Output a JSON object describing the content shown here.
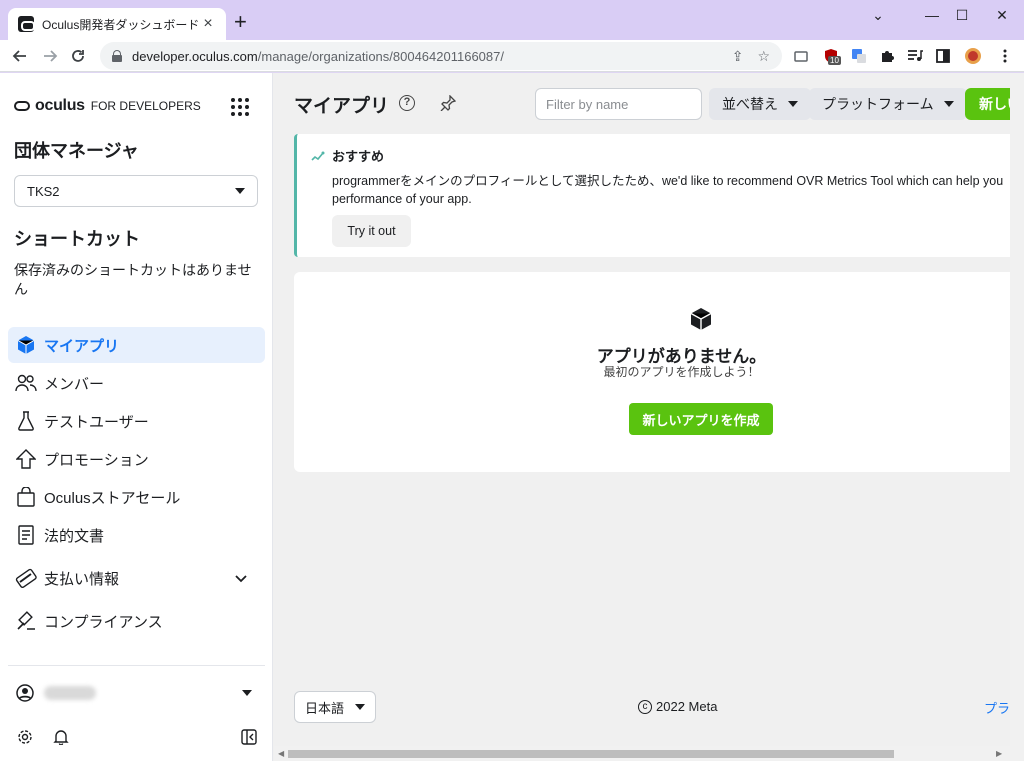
{
  "browser": {
    "tab_title": "Oculus開発者ダッシュボード",
    "tab_close": "×",
    "new_tab": "+",
    "url_host": "developer.oculus.com",
    "url_path": "/manage/organizations/800464201166087/",
    "window_controls": [
      "⌄",
      "—",
      "☐",
      "✕"
    ],
    "ext_badge": "10"
  },
  "sidebar": {
    "brand_name": "oculus",
    "brand_sub": "FOR DEVELOPERS",
    "org_heading": "団体マネージャ",
    "org_selected": "TKS2",
    "shortcuts_heading": "ショートカット",
    "shortcuts_empty": "保存済みのショートカットはありません",
    "nav": [
      {
        "label": "マイアプリ",
        "icon": "cube-icon",
        "active": true
      },
      {
        "label": "メンバー",
        "icon": "people-icon"
      },
      {
        "label": "テストユーザー",
        "icon": "flask-icon"
      },
      {
        "label": "プロモーション",
        "icon": "arrow-up-icon"
      },
      {
        "label": "Oculusストアセール",
        "icon": "shopping-bag-icon"
      },
      {
        "label": "法的文書",
        "icon": "document-icon"
      },
      {
        "label": "支払い情報",
        "icon": "card-icon"
      },
      {
        "label": "コンプライアンス",
        "icon": "gavel-icon"
      }
    ]
  },
  "main": {
    "title": "マイアプリ",
    "filter_placeholder": "Filter by name",
    "sort_label": "並べ替え",
    "platform_label": "プラットフォーム",
    "new_button_partial": "新しい",
    "recommendation": {
      "heading": "おすすめ",
      "body_line1": "programmerをメインのプロフィールとして選択したため、we'd like to recommend OVR Metrics Tool which can help you",
      "body_line2": "performance of your app.",
      "button": "Try it out"
    },
    "empty_state": {
      "title": "アプリがありません。",
      "subtitle": "最初のアプリを作成しよう！",
      "button": "新しいアプリを作成"
    },
    "footer": {
      "language": "日本語",
      "copyright": "2022 Meta",
      "copyright_symbol": "c",
      "link_partial": "プラ"
    }
  },
  "colors": {
    "accent_green": "#5ac30f",
    "active_blue": "#1876f2",
    "rec_border": "#53b6a8"
  }
}
